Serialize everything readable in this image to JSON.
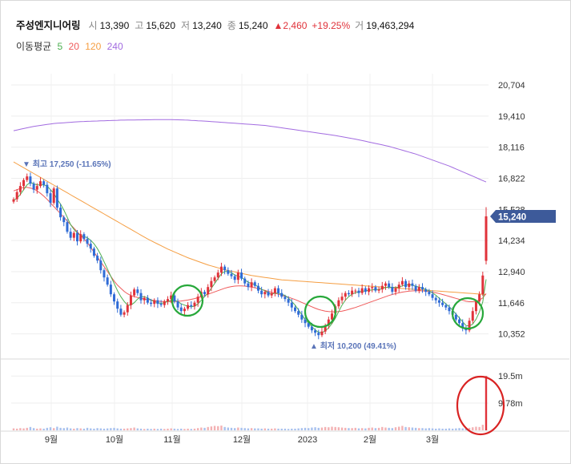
{
  "header": {
    "name": "주성엔지니어링",
    "open_label": "시",
    "open": "13,390",
    "high_label": "고",
    "high": "15,620",
    "low_label": "저",
    "low": "13,240",
    "close_label": "종",
    "close": "15,240",
    "change": "▲2,460",
    "change_pct": "+19.25%",
    "vol_label": "거",
    "volume": "19,463,294"
  },
  "ma_legend": {
    "title": "이동평균",
    "items": [
      {
        "label": "5",
        "color": "#4caf50"
      },
      {
        "label": "20",
        "color": "#ef5a5a"
      },
      {
        "label": "120",
        "color": "#f59e42"
      },
      {
        "label": "240",
        "color": "#a26be0"
      }
    ]
  },
  "colors": {
    "up": "#e0323a",
    "down": "#2f6bd6",
    "price_tag": "#3d5a9a",
    "annotation": "#5a74b8",
    "circle": "#27a83a",
    "volume_circle": "#d92323"
  },
  "chart_data": {
    "type": "candlestick",
    "y_ticks": [
      "20,704",
      "19,410",
      "18,116",
      "16,822",
      "15,528",
      "14,234",
      "12,940",
      "11,646",
      "10,352"
    ],
    "x_ticks": [
      "9월",
      "10월",
      "11월",
      "12월",
      "2023",
      "2월",
      "3월"
    ],
    "volume_ticks": [
      "19.5m",
      "9.78m"
    ],
    "last_price": "15,240",
    "annotations": {
      "high": {
        "arrow": "▼",
        "label": "최고",
        "value": "17,250",
        "pct": "(-11.65%)"
      },
      "low": {
        "arrow": "▲",
        "label": "최저",
        "value": "10,200",
        "pct": "(49.41%)"
      }
    },
    "ylim": [
      9900,
      21300
    ],
    "closes": [
      15950,
      16250,
      16500,
      16750,
      16900,
      16600,
      16350,
      16500,
      16700,
      16550,
      16200,
      15800,
      16400,
      15600,
      15200,
      15000,
      14600,
      14350,
      14550,
      14200,
      14500,
      14300,
      14100,
      13900,
      13600,
      13400,
      13000,
      12700,
      12400,
      12000,
      11700,
      11400,
      11150,
      11250,
      11550,
      11950,
      12200,
      12050,
      11750,
      11850,
      11650,
      11600,
      11750,
      11600,
      11550,
      11700,
      11800,
      11950,
      11700,
      11450,
      11300,
      11400,
      11550,
      11500,
      11650,
      11900,
      12100,
      12000,
      12300,
      12550,
      12700,
      12900,
      13150,
      13000,
      12850,
      12750,
      12600,
      12900,
      12650,
      12450,
      12300,
      12500,
      12350,
      12150,
      12000,
      12100,
      11950,
      12050,
      12250,
      12050,
      11900,
      11800,
      11650,
      11450,
      11300,
      11150,
      10950,
      10800,
      10650,
      10500,
      10400,
      10300,
      10450,
      10700,
      10950,
      11200,
      11500,
      11750,
      11900,
      12050,
      12000,
      12150,
      12150,
      12050,
      12250,
      12100,
      12250,
      12300,
      12150,
      12200,
      12350,
      12450,
      12300,
      12100,
      12250,
      12400,
      12550,
      12300,
      12450,
      12350,
      12150,
      12300,
      12200,
      12100,
      12000,
      11850,
      11750,
      11650,
      11550,
      11450,
      11300,
      11150,
      10950,
      10800,
      10600,
      10500,
      10900,
      11300,
      11700,
      12000,
      12780,
      15240
    ],
    "ma5": [
      15900,
      16000,
      16150,
      16350,
      16550,
      16650,
      16600,
      16550,
      16550,
      16550,
      16500,
      16350,
      16200,
      15950,
      15750,
      15500,
      15200,
      14900,
      14700,
      14550,
      14450,
      14400,
      14350,
      14250,
      14100,
      13900,
      13650,
      13350,
      13050,
      12750,
      12450,
      12150,
      11900,
      11700,
      11550,
      11550,
      11650,
      11800,
      11900,
      11900,
      11850,
      11750,
      11700,
      11650,
      11620,
      11650,
      11700,
      11750,
      11750,
      11700,
      11600,
      11550,
      11500,
      11480,
      11500,
      11600,
      11750,
      11900,
      12050,
      12250,
      12450,
      12650,
      12850,
      12950,
      12950,
      12900,
      12800,
      12750,
      12700,
      12600,
      12500,
      12450,
      12400,
      12300,
      12200,
      12150,
      12050,
      12000,
      12050,
      12050,
      12000,
      11950,
      11850,
      11700,
      11550,
      11350,
      11150,
      10950,
      10800,
      10650,
      10520,
      10420,
      10400,
      10480,
      10600,
      10780,
      11000,
      11280,
      11550,
      11760,
      11900,
      12000,
      12070,
      12100,
      12120,
      12150,
      12160,
      12180,
      12200,
      12200,
      12240,
      12280,
      12300,
      12290,
      12280,
      12300,
      12350,
      12380,
      12400,
      12380,
      12330,
      12300,
      12260,
      12200,
      12140,
      12060,
      11960,
      11840,
      11720,
      11600,
      11480,
      11340,
      11180,
      11020,
      10860,
      10700,
      10680,
      10760,
      10960,
      11260,
      11680,
      12620
    ],
    "ma20": [
      16300,
      16350,
      16400,
      16450,
      16450,
      16420,
      16380,
      16300,
      16200,
      16080,
      15950,
      15800,
      15650,
      15500,
      15350,
      15200,
      15050,
      14900,
      14750,
      14600,
      14450,
      14300,
      14150,
      13950,
      13750,
      13550,
      13350,
      13150,
      12950,
      12750,
      12550,
      12380,
      12250,
      12120,
      12020,
      11950,
      11900,
      11870,
      11840,
      11800,
      11780,
      11760,
      11740,
      11720,
      11700,
      11700,
      11700,
      11700,
      11700,
      11710,
      11720,
      11740,
      11760,
      11790,
      11820,
      11860,
      11900,
      11950,
      12000,
      12050,
      12100,
      12150,
      12200,
      12250,
      12290,
      12320,
      12340,
      12350,
      12350,
      12340,
      12320,
      12300,
      12270,
      12240,
      12200,
      12160,
      12120,
      12080,
      12040,
      12000,
      11960,
      11920,
      11880,
      11830,
      11780,
      11720,
      11660,
      11600,
      11540,
      11480,
      11420,
      11370,
      11330,
      11300,
      11280,
      11270,
      11270,
      11280,
      11300,
      11330,
      11370,
      11410,
      11450,
      11500,
      11550,
      11600,
      11650,
      11700,
      11750,
      11800,
      11850,
      11900,
      11950,
      11990,
      12030,
      12060,
      12090,
      12110,
      12130,
      12140,
      12150,
      12150,
      12140,
      12130,
      12110,
      12090,
      12060,
      12030,
      11990,
      11950,
      11910,
      11870,
      11830,
      11790,
      11750,
      11710,
      11690,
      11690,
      11710,
      11760,
      11850,
      12030
    ],
    "ma120": [
      17500,
      17420,
      17340,
      17260,
      17180,
      17100,
      17020,
      16940,
      16860,
      16780,
      16700,
      16620,
      16540,
      16460,
      16380,
      16300,
      16220,
      16140,
      16060,
      15980,
      15900,
      15820,
      15740,
      15660,
      15580,
      15500,
      15420,
      15340,
      15260,
      15180,
      15100,
      15020,
      14940,
      14860,
      14780,
      14700,
      14620,
      14540,
      14460,
      14380,
      14300,
      14230,
      14160,
      14090,
      14020,
      13950,
      13880,
      13820,
      13760,
      13700,
      13640,
      13580,
      13520,
      13470,
      13420,
      13370,
      13320,
      13270,
      13220,
      13180,
      13140,
      13100,
      13060,
      13020,
      12990,
      12960,
      12930,
      12900,
      12870,
      12840,
      12810,
      12780,
      12760,
      12740,
      12720,
      12700,
      12680,
      12660,
      12640,
      12620,
      12600,
      12590,
      12580,
      12570,
      12560,
      12550,
      12540,
      12530,
      12520,
      12510,
      12500,
      12490,
      12480,
      12470,
      12460,
      12450,
      12440,
      12430,
      12420,
      12410,
      12400,
      12390,
      12380,
      12370,
      12360,
      12350,
      12340,
      12330,
      12320,
      12310,
      12300,
      12290,
      12280,
      12270,
      12260,
      12250,
      12240,
      12230,
      12220,
      12210,
      12200,
      12190,
      12180,
      12170,
      12160,
      12150,
      12140,
      12130,
      12120,
      12110,
      12100,
      12090,
      12080,
      12070,
      12060,
      12050,
      12040,
      12030,
      12020,
      12010,
      12000,
      11990
    ],
    "ma240": [
      18800,
      18830,
      18860,
      18890,
      18920,
      18950,
      18980,
      19000,
      19020,
      19040,
      19060,
      19080,
      19100,
      19110,
      19120,
      19130,
      19140,
      19150,
      19160,
      19170,
      19180,
      19185,
      19190,
      19195,
      19200,
      19205,
      19210,
      19215,
      19220,
      19225,
      19230,
      19235,
      19240,
      19242,
      19244,
      19246,
      19248,
      19250,
      19252,
      19254,
      19256,
      19258,
      19260,
      19260,
      19260,
      19260,
      19260,
      19260,
      19258,
      19255,
      19250,
      19245,
      19240,
      19232,
      19224,
      19216,
      19208,
      19200,
      19190,
      19180,
      19170,
      19160,
      19150,
      19140,
      19130,
      19120,
      19110,
      19100,
      19090,
      19080,
      19070,
      19060,
      19050,
      19040,
      19030,
      19020,
      19000,
      18980,
      18960,
      18940,
      18920,
      18900,
      18880,
      18860,
      18840,
      18820,
      18800,
      18780,
      18760,
      18740,
      18720,
      18700,
      18680,
      18660,
      18640,
      18620,
      18600,
      18575,
      18550,
      18525,
      18500,
      18475,
      18450,
      18420,
      18390,
      18360,
      18330,
      18300,
      18270,
      18240,
      18210,
      18180,
      18150,
      18110,
      18070,
      18030,
      17990,
      17950,
      17910,
      17870,
      17830,
      17780,
      17730,
      17680,
      17630,
      17580,
      17530,
      17480,
      17430,
      17380,
      17330,
      17270,
      17210,
      17150,
      17090,
      17030,
      16970,
      16910,
      16850,
      16790,
      16730,
      16670
    ],
    "volume": [
      0.7,
      0.6,
      0.8,
      0.7,
      0.9,
      1.2,
      0.8,
      0.6,
      0.7,
      0.6,
      0.9,
      1.1,
      0.8,
      1.3,
      0.9,
      0.8,
      1.0,
      0.7,
      0.6,
      0.8,
      0.7,
      0.6,
      0.9,
      0.7,
      0.6,
      0.8,
      0.7,
      0.6,
      0.7,
      0.8,
      0.9,
      0.7,
      0.6,
      0.6,
      0.7,
      0.8,
      1.0,
      0.7,
      0.6,
      0.5,
      0.6,
      0.5,
      0.6,
      0.5,
      0.6,
      0.5,
      0.6,
      0.7,
      0.6,
      0.5,
      0.6,
      0.5,
      0.6,
      0.5,
      0.6,
      0.8,
      1.0,
      0.9,
      1.2,
      1.4,
      1.6,
      1.5,
      1.7,
      1.2,
      1.0,
      0.9,
      0.8,
      1.0,
      0.9,
      0.8,
      0.7,
      0.8,
      0.7,
      0.7,
      0.6,
      0.7,
      0.6,
      0.6,
      0.7,
      0.6,
      0.6,
      0.6,
      0.5,
      0.6,
      0.6,
      0.7,
      0.8,
      0.9,
      0.8,
      1.0,
      1.1,
      0.9,
      1.0,
      1.2,
      1.1,
      1.3,
      1.2,
      1.1,
      1.0,
      0.9,
      0.8,
      0.8,
      0.9,
      0.7,
      0.8,
      0.7,
      0.9,
      1.0,
      0.8,
      0.9,
      1.2,
      1.0,
      0.9,
      0.8,
      1.1,
      1.3,
      1.6,
      1.2,
      1.1,
      1.0,
      0.9,
      0.8,
      0.8,
      0.7,
      0.8,
      0.7,
      0.6,
      0.7,
      0.6,
      0.6,
      0.7,
      0.6,
      0.7,
      0.8,
      0.7,
      0.6,
      0.9,
      1.1,
      1.3,
      1.2,
      2.0,
      19.46
    ],
    "volume_max": 21
  }
}
